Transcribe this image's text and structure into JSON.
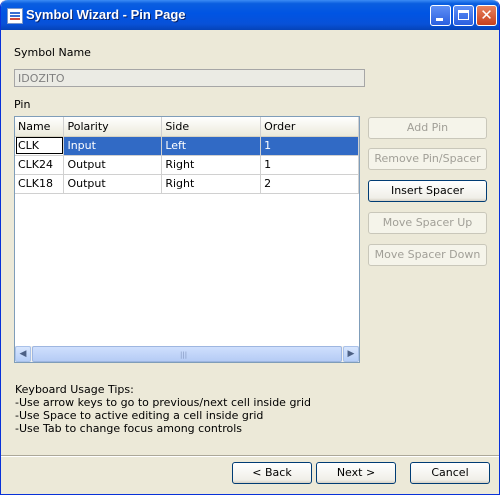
{
  "window": {
    "title": "Symbol Wizard - Pin Page",
    "close_glyph": "✕"
  },
  "symbol": {
    "label": "Symbol Name",
    "value": "IDOZITO"
  },
  "pin_label": "Pin",
  "grid": {
    "columns": [
      "Name",
      "Polarity",
      "Side",
      "Order"
    ],
    "rows": [
      {
        "name": "CLK",
        "polarity": "Input",
        "side": "Left",
        "order": "1"
      },
      {
        "name": "CLK24",
        "polarity": "Output",
        "side": "Right",
        "order": "1"
      },
      {
        "name": "CLK18",
        "polarity": "Output",
        "side": "Right",
        "order": "2"
      }
    ],
    "scroll_left": "◀",
    "scroll_right": "▶",
    "grip": "|||"
  },
  "side_buttons": {
    "add_pin": "Add Pin",
    "remove_pin": "Remove Pin/Spacer",
    "insert_spacer": "Insert Spacer",
    "move_up": "Move Spacer Up",
    "move_down": "Move Spacer Down"
  },
  "tips": {
    "heading": "Keyboard Usage Tips:",
    "line1": "-Use arrow keys to go to previous/next cell inside grid",
    "line2": "-Use Space to active editing a cell inside grid",
    "line3": "-Use Tab to change focus among controls"
  },
  "footer": {
    "back": "< Back",
    "next": "Next >",
    "cancel": "Cancel"
  },
  "colors": {
    "titlebar": "#0054e3",
    "selection": "#316ac5",
    "dialog_bg": "#ece9d8"
  }
}
